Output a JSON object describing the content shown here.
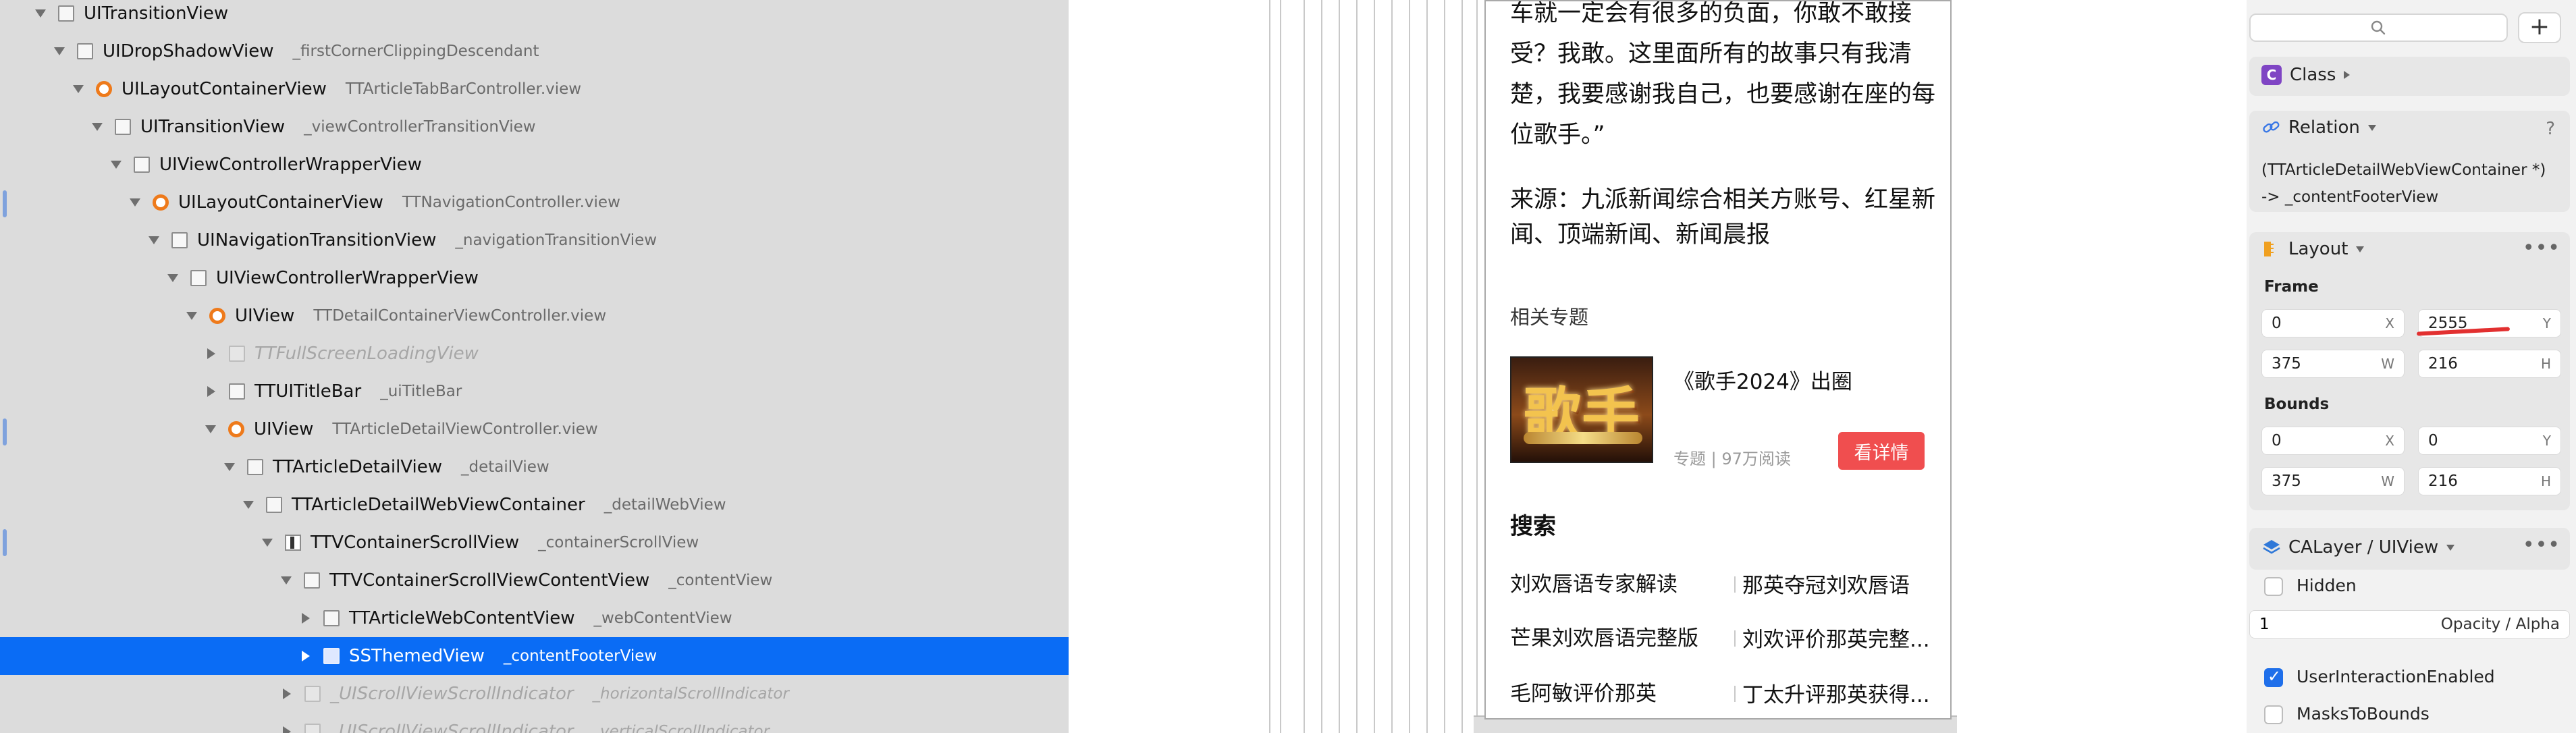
{
  "tree": {
    "rows": [
      {
        "cls": "UITransitionView",
        "sub": ""
      },
      {
        "cls": "UIDropShadowView",
        "sub": "_firstCornerClippingDescendant"
      },
      {
        "cls": "UILayoutContainerView",
        "sub": "TTArticleTabBarController.view"
      },
      {
        "cls": "UITransitionView",
        "sub": "_viewControllerTransitionView"
      },
      {
        "cls": "UIViewControllerWrapperView",
        "sub": ""
      },
      {
        "cls": "UILayoutContainerView",
        "sub": "TTNavigationController.view"
      },
      {
        "cls": "UINavigationTransitionView",
        "sub": "_navigationTransitionView"
      },
      {
        "cls": "UIViewControllerWrapperView",
        "sub": ""
      },
      {
        "cls": "UIView",
        "sub": "TTDetailContainerViewController.view"
      },
      {
        "cls": "TTFullScreenLoadingView",
        "sub": ""
      },
      {
        "cls": "TTUITitleBar",
        "sub": "_uiTitleBar"
      },
      {
        "cls": "UIView",
        "sub": "TTArticleDetailViewController.view"
      },
      {
        "cls": "TTArticleDetailView",
        "sub": "_detailView"
      },
      {
        "cls": "TTArticleDetailWebViewContainer",
        "sub": "_detailWebView"
      },
      {
        "cls": "TTVContainerScrollView",
        "sub": "_containerScrollView"
      },
      {
        "cls": "TTVContainerScrollViewContentView",
        "sub": "_contentView"
      },
      {
        "cls": "TTArticleWebContentView",
        "sub": "_webContentView"
      },
      {
        "cls": "SSThemedView",
        "sub": "_contentFooterView"
      },
      {
        "cls": "_UIScrollViewScrollIndicator",
        "sub": "_horizontalScrollIndicator"
      },
      {
        "cls": "_UIScrollViewScrollIndicator",
        "sub": "_verticalScrollIndicator"
      }
    ]
  },
  "article": {
    "lines": [
      "车就一定会有很多的负面，你敢不敢接",
      "受？我敢。这里面所有的故事只有我清",
      "楚，我要感谢我自己，也要感谢在座的每",
      "位歌手。”"
    ],
    "source_lines": [
      "来源：九派新闻综合相关方账号、红星新",
      "闻、顶端新闻、新闻晨报"
    ],
    "topic_header": "相关专题",
    "thumb_glyph": "歌手",
    "topic_title": "《歌手2024》出圈",
    "topic_meta": "专题 | 97万阅读",
    "detail_button": "看详情",
    "search_header": "搜索",
    "search_items": [
      [
        "刘欢唇语专家解读",
        "那英夺冠刘欢唇语"
      ],
      [
        "芒果刘欢唇语完整版",
        "刘欢评价那英完整..."
      ],
      [
        "毛阿敏评价那英",
        "丁太升评那英获得..."
      ]
    ]
  },
  "inspector": {
    "search_icon": "magnifier-icon",
    "plus_label": "+",
    "class_badge": "C",
    "class_label": "Class",
    "relation_label": "Relation",
    "relation_help": "?",
    "relation_lines": [
      "(TTArticleDetailWebViewContainer *)",
      "-> _contentFooterView"
    ],
    "layout_label": "Layout",
    "more_label": "•••",
    "frame_label": "Frame",
    "frame": {
      "x": "0",
      "y": "2555",
      "w": "375",
      "h": "216"
    },
    "bounds_label": "Bounds",
    "bounds": {
      "x": "0",
      "y": "0",
      "w": "375",
      "h": "216"
    },
    "axis": {
      "x": "X",
      "y": "Y",
      "w": "W",
      "h": "H"
    },
    "calayer_label": "CALayer / UIView",
    "hidden_label": "Hidden",
    "opacity_value": "1",
    "opacity_label": "Opacity / Alpha",
    "uie_label": "UserInteractionEnabled",
    "mtb_label": "MasksToBounds",
    "accent": "#0a6cf5"
  }
}
